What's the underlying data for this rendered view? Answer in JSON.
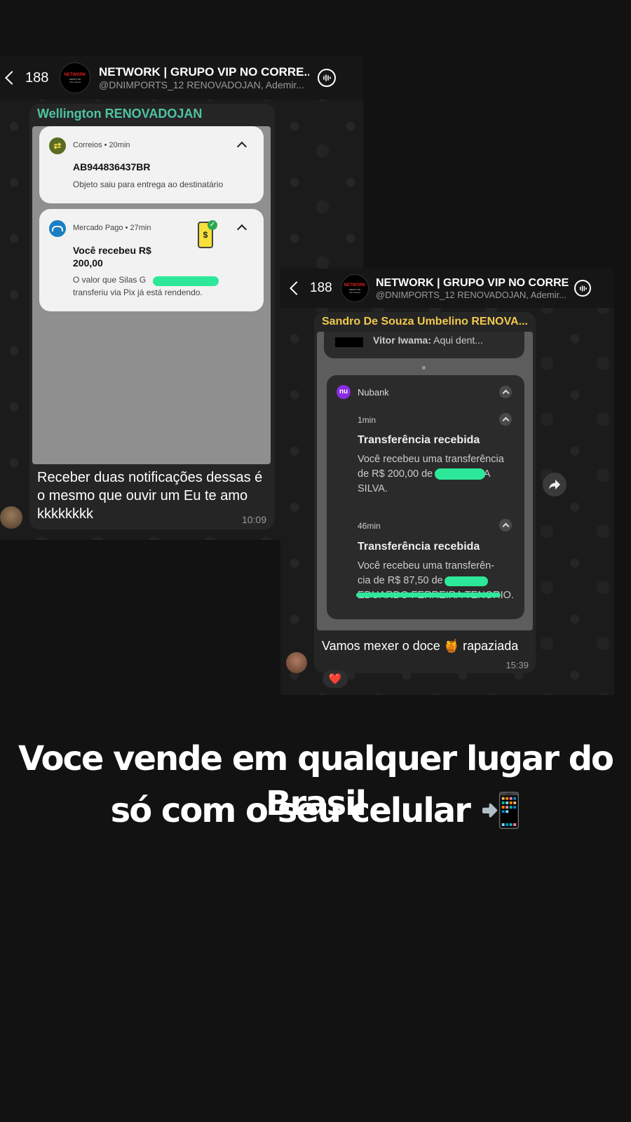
{
  "left": {
    "header": {
      "back_count": "188",
      "title": "NETWORK | GRUPO VIP NO CORRE...",
      "subtitle": "@DNIMPORTS_12 RENOVADOJAN, Ademir...",
      "avatar_text": [
        "NETWORK",
        "GRUPO VIP",
        "Vitor Iwama"
      ]
    },
    "message": {
      "sender": "Wellington RENOVADOJAN",
      "notifications": [
        {
          "app": "Correios",
          "age": "20min",
          "title": "AB944836437BR",
          "body": "Objeto saiu para entrega ao destinatário"
        },
        {
          "app": "Mercado Pago",
          "age": "27min",
          "title": "Você recebeu R$ 200,00",
          "body_line1": "O valor que Silas G",
          "body_line2": "transferiu via Pix já está rendendo."
        }
      ],
      "text": "Receber duas notificações dessas é o mesmo que ouvir um Eu te amo kkkkkkkk",
      "time": "10:09"
    }
  },
  "right": {
    "header": {
      "back_count": "188",
      "title": "NETWORK | GRUPO VIP NO CORRE...",
      "subtitle": "@DNIMPORTS_12 RENOVADOJAN, Ademir..."
    },
    "message": {
      "sender": "Sandro De Souza Umbelino RENOVA...",
      "prev_preview_name": "Vitor Iwama:",
      "prev_preview_text": " Aqui dent...",
      "nubank": {
        "app": "Nubank",
        "logo": "nu",
        "items": [
          {
            "age": "1min",
            "title": "Transferência recebida",
            "line1": "Você recebeu uma transferência",
            "line2": "de R$ 200,00 de",
            "line2_end": "DA",
            "line3": "SILVA."
          },
          {
            "age": "46min",
            "title": "Transferência recebida",
            "line1": "Você recebeu uma transferên-",
            "line2": "cia de R$ 87,50 de",
            "line3": "EDUARDO FERREIRA TENORIO."
          }
        ]
      },
      "text": "Vamos mexer o doce 🍯 rapaziada",
      "time": "15:39",
      "reaction": "❤️"
    }
  },
  "caption": {
    "line1": "Voce vende em qualquer lugar do Brasil",
    "line2": "só com o seu celular 📲"
  },
  "colors": {
    "sender_left": "#4fc3a1",
    "sender_right": "#f2c94c",
    "scribble": "#2ee89a",
    "background": "#121212"
  }
}
